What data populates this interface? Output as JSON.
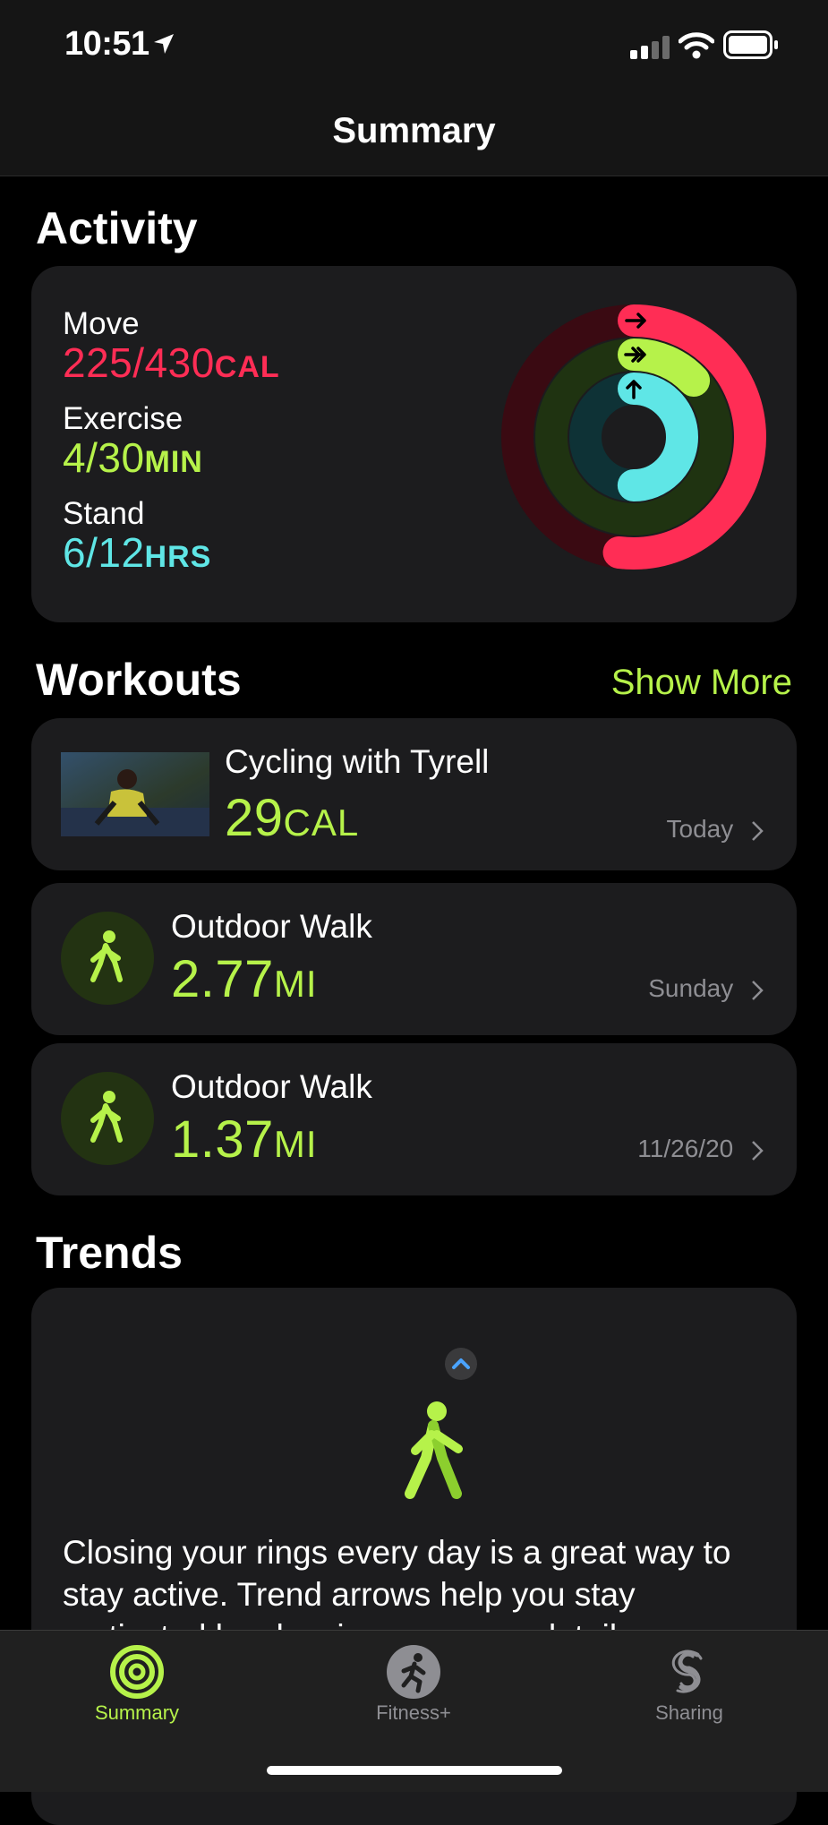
{
  "status_bar": {
    "time": "10:51"
  },
  "nav": {
    "title": "Summary"
  },
  "activity": {
    "heading": "Activity",
    "move": {
      "label": "Move",
      "value": "225/430",
      "unit": "CAL",
      "color": "#ff2d55"
    },
    "exercise": {
      "label": "Exercise",
      "value": "4/30",
      "unit": "MIN",
      "color": "#b6f24a"
    },
    "stand": {
      "label": "Stand",
      "value": "6/12",
      "unit": "HRS",
      "color": "#5fe6e6"
    },
    "rings": {
      "move_progress": 0.52,
      "exercise_progress": 0.13,
      "stand_progress": 0.5
    }
  },
  "workouts": {
    "heading": "Workouts",
    "show_more": "Show More",
    "items": [
      {
        "title": "Cycling with Tyrell",
        "value": "29",
        "unit": "CAL",
        "date": "Today"
      },
      {
        "title": "Outdoor Walk",
        "value": "2.77",
        "unit": "MI",
        "date": "Sunday"
      },
      {
        "title": "Outdoor Walk",
        "value": "1.37",
        "unit": "MI",
        "date": "11/26/20"
      }
    ]
  },
  "trends": {
    "heading": "Trends",
    "body": "Closing your rings every day is a great way to stay active. Trend arrows help you stay motivated by showing you more details."
  },
  "tabbar": {
    "tabs": [
      {
        "label": "Summary",
        "icon": "activity-rings-icon",
        "active": true
      },
      {
        "label": "Fitness+",
        "icon": "runner-icon",
        "active": false
      },
      {
        "label": "Sharing",
        "icon": "sharing-icon",
        "active": false
      }
    ]
  },
  "colors": {
    "accent": "#b6f24a",
    "move": "#ff2d55",
    "stand": "#5fe6e6"
  }
}
